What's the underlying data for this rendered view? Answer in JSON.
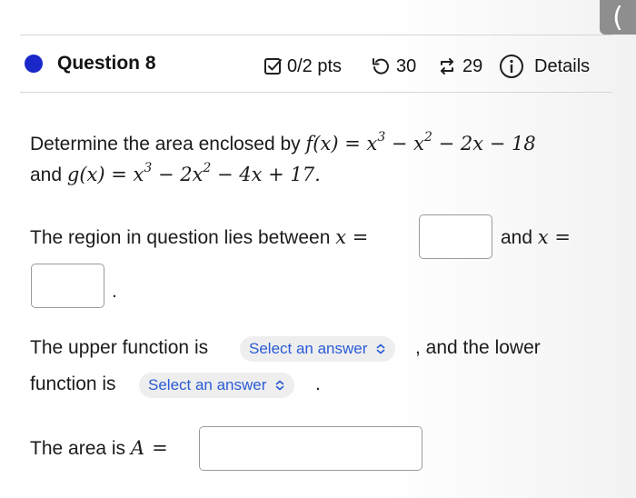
{
  "nav": {
    "back_glyph": "("
  },
  "question": {
    "title": "Question 8",
    "status_color": "#1a28c9",
    "points": "0/2 pts",
    "retries": "30",
    "submissions": "29",
    "details_label": "Details"
  },
  "problem": {
    "l1_text": "Determine the area enclosed by ",
    "f_def": "f(x) = x",
    "f_exp1": "3",
    "f_mid": " − x",
    "f_exp2": "2",
    "f_end": " − 2x − 18",
    "l2_and": "and ",
    "g_def": "g(x) = x",
    "g_exp1": "3",
    "g_mid": " − 2x",
    "g_exp2": "2",
    "g_end": " − 4x + 17.",
    "region_text": "The region in question lies between ",
    "x_eq": "x =",
    "and_text": "and ",
    "x_eq2": "x =",
    "period": ".",
    "upper_text": "The upper function is",
    "upper_select": "Select an answer",
    "lower_text": ", and the lower",
    "function_is": "function is",
    "lower_select": "Select an answer",
    "period2": ".",
    "area_text": "The area is ",
    "area_var": "A",
    "area_eq": "="
  },
  "icons": {
    "checkbox": "checkbox-icon",
    "retry": "retry-icon",
    "submissions": "submissions-icon",
    "info": "info-icon"
  }
}
